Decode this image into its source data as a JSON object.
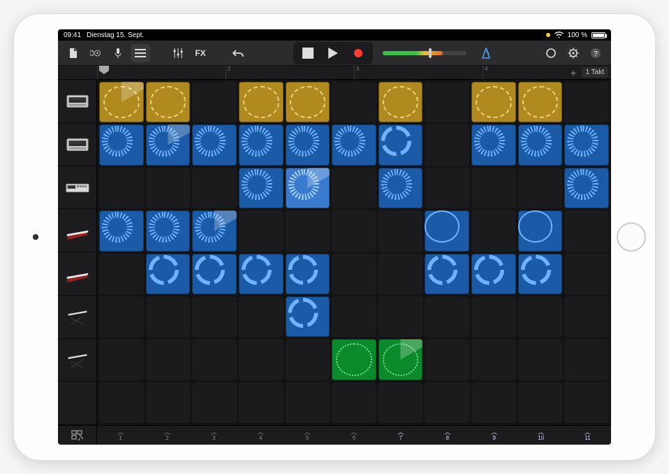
{
  "status": {
    "time": "09:41",
    "date": "Dienstag 15. Sept.",
    "battery_pct": "100 %",
    "wifi": true
  },
  "toolbar": {
    "undo_label": "Undo"
  },
  "ruler": {
    "bars": [
      "1",
      "2",
      "3",
      "4"
    ],
    "takt_label": "1 Takt",
    "playhead_col": 0
  },
  "tracks": [
    {
      "name": "drum-machine-1",
      "kind": "drum-yellow"
    },
    {
      "name": "drum-machine-2",
      "kind": "drum-blue"
    },
    {
      "name": "sampler",
      "kind": "sampler"
    },
    {
      "name": "keys-red",
      "kind": "keys-red"
    },
    {
      "name": "keys-red-2",
      "kind": "keys-red"
    },
    {
      "name": "keys-stand-1",
      "kind": "keys-stand"
    },
    {
      "name": "keys-stand-2",
      "kind": "keys-stand"
    },
    {
      "name": "empty",
      "kind": "blank"
    }
  ],
  "grid": {
    "cols": 11,
    "rows": 8,
    "cells": [
      {
        "r": 0,
        "c": 0,
        "color": "yellow",
        "shape": "wave",
        "playing": true
      },
      {
        "r": 0,
        "c": 1,
        "color": "yellow",
        "shape": "wave"
      },
      {
        "r": 0,
        "c": 3,
        "color": "yellow",
        "shape": "wave"
      },
      {
        "r": 0,
        "c": 4,
        "color": "yellow",
        "shape": "wave"
      },
      {
        "r": 0,
        "c": 6,
        "color": "yellow",
        "shape": "wave"
      },
      {
        "r": 0,
        "c": 8,
        "color": "yellow",
        "shape": "wave"
      },
      {
        "r": 0,
        "c": 9,
        "color": "yellow",
        "shape": "wave"
      },
      {
        "r": 1,
        "c": 0,
        "color": "blue",
        "shape": "spiky"
      },
      {
        "r": 1,
        "c": 1,
        "color": "blue",
        "shape": "spiky",
        "playing": true
      },
      {
        "r": 1,
        "c": 2,
        "color": "blue",
        "shape": "spiky"
      },
      {
        "r": 1,
        "c": 3,
        "color": "blue",
        "shape": "spiky"
      },
      {
        "r": 1,
        "c": 4,
        "color": "blue",
        "shape": "spiky"
      },
      {
        "r": 1,
        "c": 5,
        "color": "blue",
        "shape": "spiky"
      },
      {
        "r": 1,
        "c": 6,
        "color": "blue",
        "shape": "arcs"
      },
      {
        "r": 1,
        "c": 8,
        "color": "blue",
        "shape": "spiky"
      },
      {
        "r": 1,
        "c": 9,
        "color": "blue",
        "shape": "spiky"
      },
      {
        "r": 1,
        "c": 10,
        "color": "blue",
        "shape": "spiky"
      },
      {
        "r": 2,
        "c": 3,
        "color": "blue",
        "shape": "spiky"
      },
      {
        "r": 2,
        "c": 4,
        "color": "blue2",
        "shape": "spiky",
        "playing": true
      },
      {
        "r": 2,
        "c": 6,
        "color": "blue",
        "shape": "spiky"
      },
      {
        "r": 2,
        "c": 10,
        "color": "blue",
        "shape": "spiky"
      },
      {
        "r": 3,
        "c": 0,
        "color": "blue",
        "shape": "spiky"
      },
      {
        "r": 3,
        "c": 1,
        "color": "blue",
        "shape": "spiky"
      },
      {
        "r": 3,
        "c": 2,
        "color": "blue",
        "shape": "spiky",
        "playing": true
      },
      {
        "r": 3,
        "c": 7,
        "color": "blue",
        "shape": "thin"
      },
      {
        "r": 3,
        "c": 9,
        "color": "blue",
        "shape": "thin"
      },
      {
        "r": 4,
        "c": 1,
        "color": "blue",
        "shape": "arcs"
      },
      {
        "r": 4,
        "c": 2,
        "color": "blue",
        "shape": "arcs"
      },
      {
        "r": 4,
        "c": 3,
        "color": "blue",
        "shape": "arcs"
      },
      {
        "r": 4,
        "c": 4,
        "color": "blue",
        "shape": "arcs"
      },
      {
        "r": 4,
        "c": 7,
        "color": "blue",
        "shape": "arcs"
      },
      {
        "r": 4,
        "c": 8,
        "color": "blue",
        "shape": "arcs"
      },
      {
        "r": 4,
        "c": 9,
        "color": "blue",
        "shape": "arcs"
      },
      {
        "r": 5,
        "c": 4,
        "color": "blue",
        "shape": "arcs"
      },
      {
        "r": 6,
        "c": 5,
        "color": "green",
        "shape": "wave"
      },
      {
        "r": 6,
        "c": 6,
        "color": "green",
        "shape": "wave",
        "playing": true
      }
    ]
  },
  "bottom": {
    "columns": [
      {
        "n": "1",
        "on": false
      },
      {
        "n": "2",
        "on": false
      },
      {
        "n": "3",
        "on": false
      },
      {
        "n": "4",
        "on": false
      },
      {
        "n": "5",
        "on": false
      },
      {
        "n": "6",
        "on": false
      },
      {
        "n": "7",
        "on": true
      },
      {
        "n": "8",
        "on": true
      },
      {
        "n": "9",
        "on": true
      },
      {
        "n": "10",
        "on": true
      },
      {
        "n": "11",
        "on": true
      }
    ]
  },
  "volume": {
    "level_pct": 72,
    "knob_pct": 55
  }
}
